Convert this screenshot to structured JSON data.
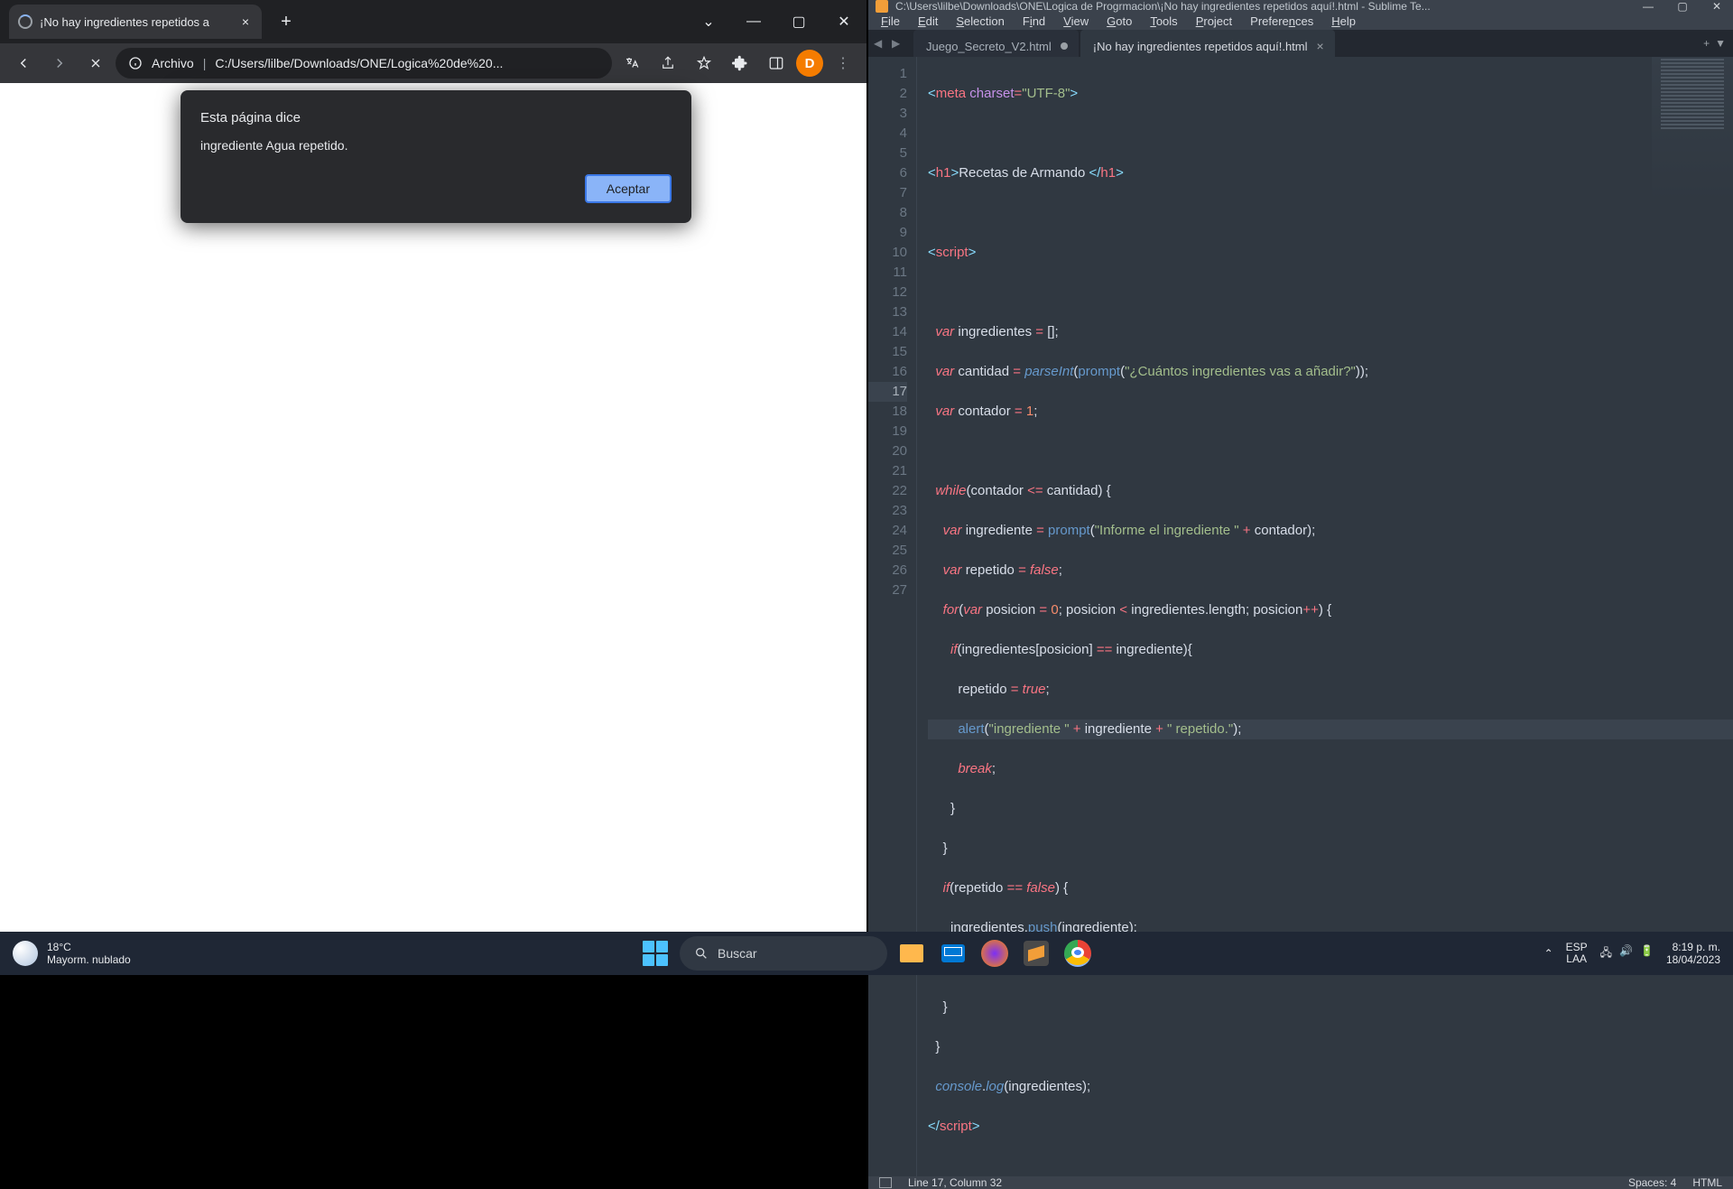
{
  "chrome": {
    "tab_title": "¡No hay ingredientes repetidos a",
    "url_label": "Archivo",
    "url": "C:/Users/lilbe/Downloads/ONE/Logica%20de%20...",
    "avatar_letter": "D",
    "dialog": {
      "title": "Esta página dice",
      "message": "ingrediente Agua repetido.",
      "ok": "Aceptar"
    }
  },
  "sublime": {
    "window_title": "C:\\Users\\lilbe\\Downloads\\ONE\\Logica de Progrmacion\\¡No hay ingredientes repetidos aquí!.html - Sublime Te...",
    "menu": [
      "File",
      "Edit",
      "Selection",
      "Find",
      "View",
      "Goto",
      "Tools",
      "Project",
      "Preferences",
      "Help"
    ],
    "tabs": [
      {
        "name": "Juego_Secreto_V2.html",
        "modified": true,
        "active": false
      },
      {
        "name": "¡No hay ingredientes repetidos aquí!.html",
        "modified": false,
        "active": true
      }
    ],
    "lines": 27,
    "status": {
      "pos": "Line 17, Column 32",
      "spaces": "Spaces: 4",
      "lang": "HTML"
    }
  },
  "taskbar": {
    "weather_temp": "18°C",
    "weather_desc": "Mayorm. nublado",
    "search": "Buscar",
    "lang1": "ESP",
    "lang2": "LAA",
    "time": "8:19 p. m.",
    "date": "18/04/2023"
  }
}
